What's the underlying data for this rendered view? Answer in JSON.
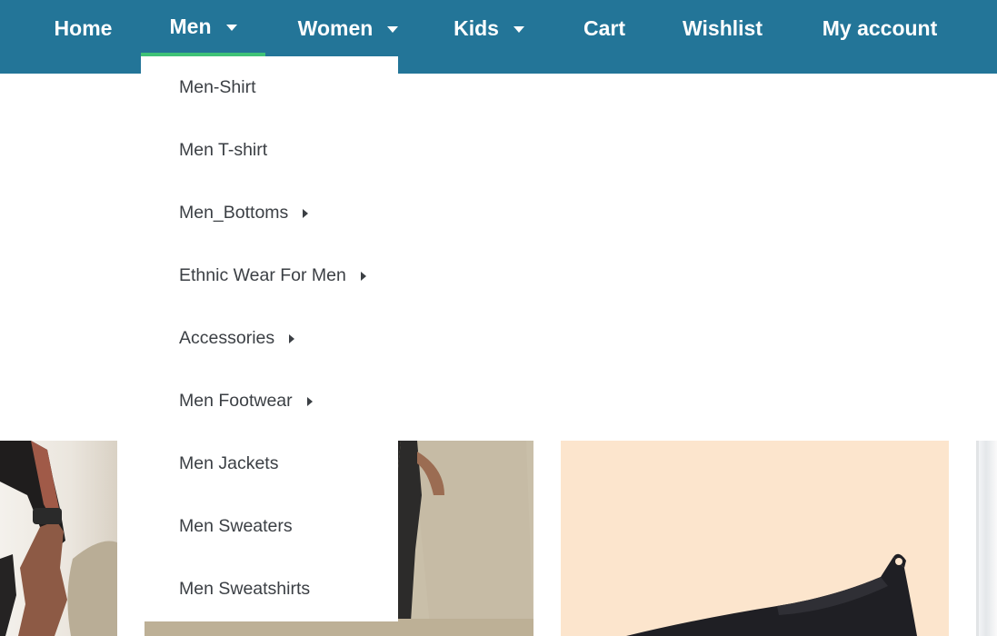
{
  "nav": {
    "home": "Home",
    "men": "Men",
    "women": "Women",
    "kids": "Kids",
    "cart": "Cart",
    "wishlist": "Wishlist",
    "account": "My account"
  },
  "dropdown": {
    "items": [
      {
        "label": "Men-Shirt",
        "has_submenu": false
      },
      {
        "label": "Men T-shirt",
        "has_submenu": false
      },
      {
        "label": "Men_Bottoms",
        "has_submenu": true
      },
      {
        "label": "Ethnic Wear For Men",
        "has_submenu": true
      },
      {
        "label": "Accessories",
        "has_submenu": true
      },
      {
        "label": "Men Footwear",
        "has_submenu": true
      },
      {
        "label": "Men Jackets",
        "has_submenu": false
      },
      {
        "label": "Men Sweaters",
        "has_submenu": false
      },
      {
        "label": "Men Sweatshirts",
        "has_submenu": false
      }
    ]
  },
  "colors": {
    "nav_background": "#237598",
    "nav_text": "#ffffff",
    "active_underline": "#3fc277",
    "menu_text": "#3b3f44"
  }
}
